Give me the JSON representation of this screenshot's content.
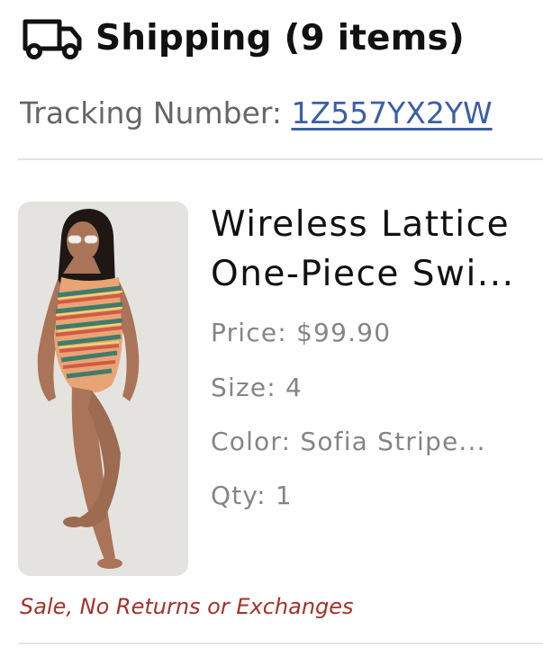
{
  "shipping": {
    "icon": "truck-icon",
    "title": "Shipping (9 items)",
    "tracking_label": "Tracking Number: ",
    "tracking_number": "1Z557YX2YW"
  },
  "item": {
    "name_line1": "Wireless Lattice",
    "name_line2": "One-Piece Swi...",
    "price": "Price: $99.90",
    "size": "Size: 4",
    "color": "Color: Sofia Stripe...",
    "qty": "Qty: 1",
    "note": "Sale, No Returns or Exchanges",
    "note_color": "#a3322a"
  },
  "colors": {
    "link": "#3a5ea8",
    "muted_text": "#858585"
  }
}
